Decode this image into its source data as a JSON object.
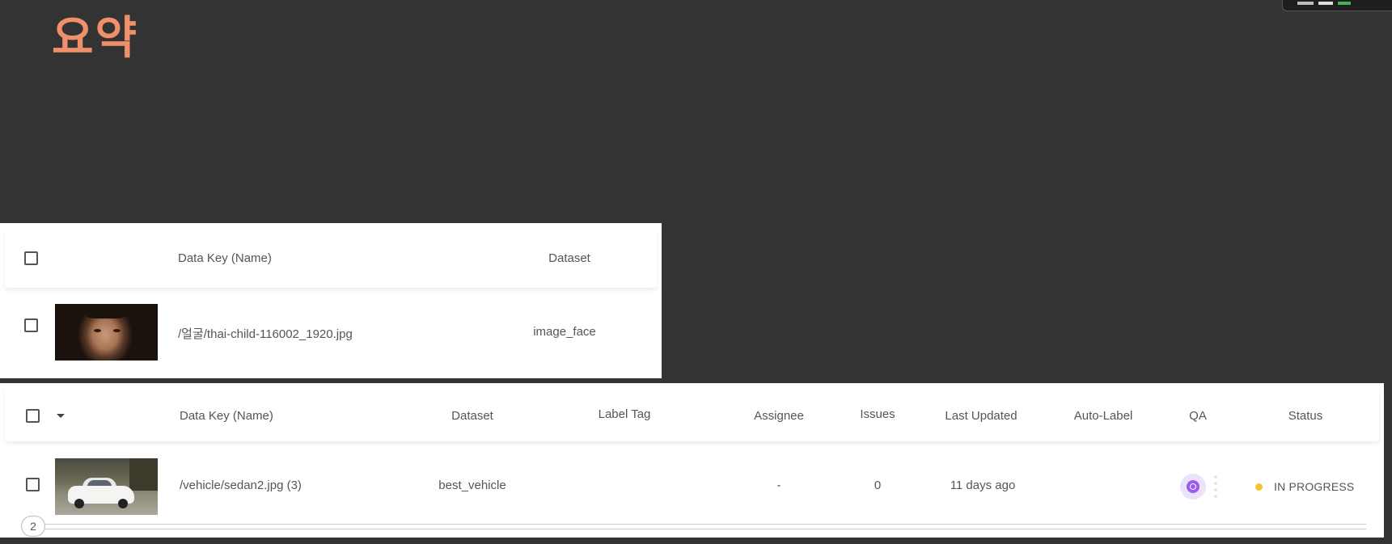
{
  "slide_title": "요약",
  "panel1": {
    "headers": {
      "data_key": "Data Key (Name)",
      "dataset": "Dataset"
    },
    "row": {
      "thumbnail": "face-photo",
      "data_key": "/얼굴/thai-child-116002_1920.jpg",
      "dataset": "image_face"
    }
  },
  "panel2": {
    "headers": {
      "data_key": "Data Key (Name)",
      "dataset": "Dataset",
      "label_tag": "Label Tag",
      "assignee": "Assignee",
      "issues": "Issues",
      "last_updated": "Last Updated",
      "auto_label": "Auto-Label",
      "qa": "QA",
      "status": "Status"
    },
    "row": {
      "thumbnail": "sedan-photo",
      "data_key": "/vehicle/sedan2.jpg (3)",
      "dataset": "best_vehicle",
      "label_tag": "",
      "assignee": "-",
      "issues": "0",
      "last_updated": "11 days ago",
      "auto_label": "",
      "qa_icon": "qa-review-icon",
      "status": "IN PROGRESS",
      "status_color": "#f4c430"
    },
    "page_indicator": "2"
  },
  "colors": {
    "background": "#333333",
    "title": "#f0906a",
    "qa_accent": "#9c5cf0"
  }
}
